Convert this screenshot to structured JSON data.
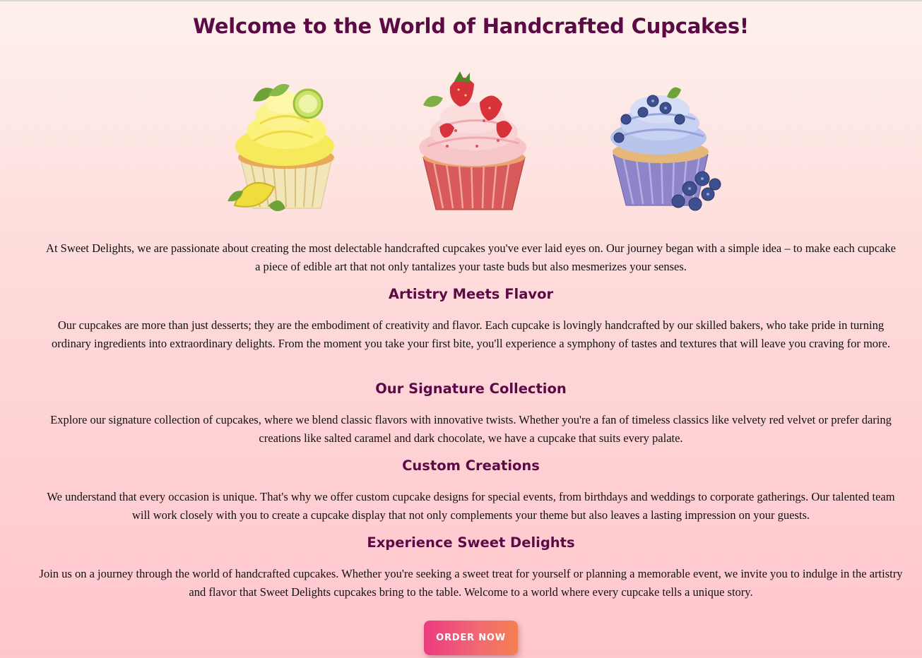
{
  "page": {
    "title": "Welcome to the World of Handcrafted Cupcakes!",
    "intro": "At Sweet Delights, we are passionate about creating the most delectable handcrafted cupcakes you've ever laid eyes on. Our journey began with a simple idea – to make each cupcake a piece of edible art that not only tantalizes your taste buds but also mesmerizes your senses."
  },
  "cupcakes": [
    {
      "icon": "lemon-cupcake-icon"
    },
    {
      "icon": "strawberry-cupcake-icon"
    },
    {
      "icon": "blueberry-cupcake-icon"
    }
  ],
  "sections": [
    {
      "heading": "Artistry Meets Flavor",
      "text": "Our cupcakes are more than just desserts; they are the embodiment of creativity and flavor. Each cupcake is lovingly handcrafted by our skilled bakers, who take pride in turning ordinary ingredients into extraordinary delights. From the moment you take your first bite, you'll experience a symphony of tastes and textures that will leave you craving for more."
    },
    {
      "heading": "Our Signature Collection",
      "text": "Explore our signature collection of cupcakes, where we blend classic flavors with innovative twists. Whether you're a fan of timeless classics like velvety red velvet or prefer daring creations like salted caramel and dark chocolate, we have a cupcake that suits every palate."
    },
    {
      "heading": "Custom Creations",
      "text": "We understand that every occasion is unique. That's why we offer custom cupcake designs for special events, from birthdays and weddings to corporate gatherings. Our talented team will work closely with you to create a cupcake display that not only complements your theme but also leaves a lasting impression on your guests."
    },
    {
      "heading": "Experience Sweet Delights",
      "text": "Join us on a journey through the world of handcrafted cupcakes. Whether you're seeking a sweet treat for yourself or planning a memorable event, we invite you to indulge in the artistry and flavor that Sweet Delights cupcakes bring to the table. Welcome to a world where every cupcake tells a unique story."
    }
  ],
  "cta": {
    "label": "ORDER NOW"
  },
  "colors": {
    "heading": "#5c0a45",
    "button_start": "#ec3b7f",
    "button_end": "#f4804f"
  }
}
